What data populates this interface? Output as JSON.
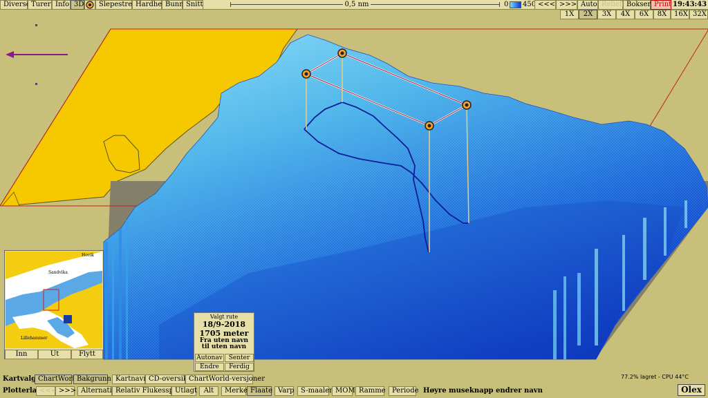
{
  "top_menu": {
    "diverse": "Diverse",
    "turer": "Turer",
    "info": "Info",
    "view3d": "3D",
    "slepestrek": "Slepestrek",
    "hardhet": "Hardhet",
    "bunn": "Bunn",
    "snitt": "Snitt"
  },
  "scale": {
    "label": "0,5 nm"
  },
  "depth": {
    "min": "0",
    "max": "450"
  },
  "controls": {
    "back": "<<<",
    "forward": ">>>",
    "auto": "Auto",
    "relieff": "Relieff",
    "bokser": "Bokser",
    "print": "Print"
  },
  "clock": "19:43:43",
  "zoom": [
    "1X",
    "2X",
    "3X",
    "4X",
    "6X",
    "8X",
    "16X",
    "32X"
  ],
  "zoom_selected": "2X",
  "minimap": {
    "place_labels": [
      "Hovik",
      "Sandvika",
      "Lillehammer"
    ],
    "buttons": {
      "inn": "Inn",
      "ut": "Ut",
      "flytt": "Flytt"
    }
  },
  "route_popup": {
    "title": "Valgt rute",
    "date": "18/9-2018",
    "length": "1705 meter",
    "from": "Fra uten navn",
    "to": "til uten navn",
    "autonav": "Autonav",
    "senter": "Senter",
    "endre": "Endre",
    "ferdig": "Ferdig"
  },
  "kartvalg": {
    "label": "Kartvalg",
    "chartworld": "ChartWorld",
    "bakgrunn": "Bakgrunn",
    "kartnavn": "Kartnavn",
    "cd_oversikt": "CD-oversikt",
    "versjoner": "ChartWorld-versjoner"
  },
  "plotterlag": {
    "label": "Plotterlag",
    "back": "<<<",
    "forward": ">>>",
    "alternativ": "Alternativ",
    "relativ": "Relativ Flukesspred",
    "utlagt": "Utlagt",
    "alt": "Alt",
    "merke": "Merke",
    "flaate": "Flaate",
    "varp": "Varp",
    "s_maaler": "S-maaler",
    "mom": "MOM",
    "ramme": "Ramme",
    "periode": "Periode",
    "hint": "Høyre museknapp endrer navn"
  },
  "status": "77.2% lagret - CPU 44°C",
  "logo": "Olex",
  "colors": {
    "land": "#f5c800",
    "background": "#c8c07a",
    "panel": "#e6e0a8",
    "shallow": "#7fd8f4",
    "deep": "#0a3ccd",
    "route": "#0a1e9a",
    "frame": "#c02020"
  }
}
